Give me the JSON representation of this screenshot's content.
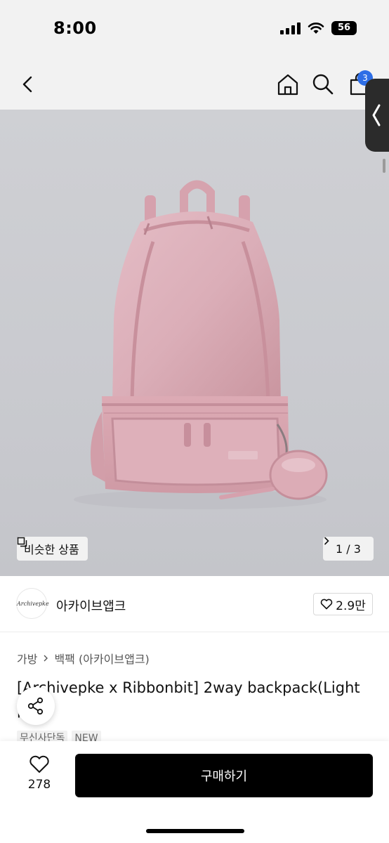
{
  "status_bar": {
    "time": "8:00",
    "battery": "56"
  },
  "nav": {
    "back_icon": "chevron-left-icon",
    "home_icon": "home-icon",
    "search_icon": "search-icon",
    "cart_icon": "shopping-bag-icon",
    "cart_count": "3"
  },
  "gallery": {
    "similar_label": "비슷한 상품",
    "current": "1",
    "total": "3",
    "pager_text": "1 / 3"
  },
  "brand": {
    "logo_text": "Archivepke",
    "name": "아카이브앱크",
    "likes": "2.9만"
  },
  "breadcrumb": {
    "items": [
      "가방",
      "백팩 (아카이브앱크)"
    ]
  },
  "product": {
    "title": "[Archivepke x Ribbonbit] 2way backpack(Light pink)",
    "tags": [
      "무신사단독",
      "NEW"
    ]
  },
  "bottom": {
    "wish_count": "278",
    "buy_label": "구매하기"
  },
  "colors": {
    "accent_badge": "#2e6ee6",
    "buy_button": "#000000",
    "backpack": "#dcaeb8"
  }
}
